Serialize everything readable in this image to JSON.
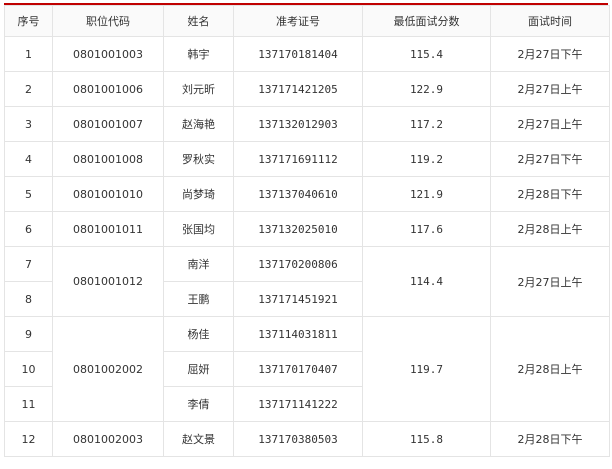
{
  "headers": {
    "seq": "序号",
    "code": "职位代码",
    "name": "姓名",
    "ticket": "准考证号",
    "score": "最低面试分数",
    "time": "面试时间"
  },
  "rows": [
    {
      "seq": "1",
      "code": "0801001003",
      "name": "韩宇",
      "ticket": "137170181404",
      "score": "115.4",
      "time": "2月27日下午"
    },
    {
      "seq": "2",
      "code": "0801001006",
      "name": "刘元昕",
      "ticket": "137171421205",
      "score": "122.9",
      "time": "2月27日上午"
    },
    {
      "seq": "3",
      "code": "0801001007",
      "name": "赵海艳",
      "ticket": "137132012903",
      "score": "117.2",
      "time": "2月27日上午"
    },
    {
      "seq": "4",
      "code": "0801001008",
      "name": "罗秋实",
      "ticket": "137171691112",
      "score": "119.2",
      "time": "2月27日下午"
    },
    {
      "seq": "5",
      "code": "0801001010",
      "name": "尚梦琦",
      "ticket": "137137040610",
      "score": "121.9",
      "time": "2月28日下午"
    },
    {
      "seq": "6",
      "code": "0801001011",
      "name": "张国均",
      "ticket": "137132025010",
      "score": "117.6",
      "time": "2月28日上午"
    },
    {
      "seq": "7",
      "code": "0801001012",
      "name": "南洋",
      "ticket": "137170200806",
      "score": "114.4",
      "time": "2月27日上午"
    },
    {
      "seq": "8",
      "name": "王鹏",
      "ticket": "137171451921"
    },
    {
      "seq": "9",
      "code": "0801002002",
      "name": "杨佳",
      "ticket": "137114031811",
      "score": "119.7",
      "time": "2月28日上午"
    },
    {
      "seq": "10",
      "name": "屈妍",
      "ticket": "137170170407"
    },
    {
      "seq": "11",
      "name": "李倩",
      "ticket": "137171141222"
    },
    {
      "seq": "12",
      "code": "0801002003",
      "name": "赵文景",
      "ticket": "137170380503",
      "score": "115.8",
      "time": "2月28日下午"
    }
  ]
}
